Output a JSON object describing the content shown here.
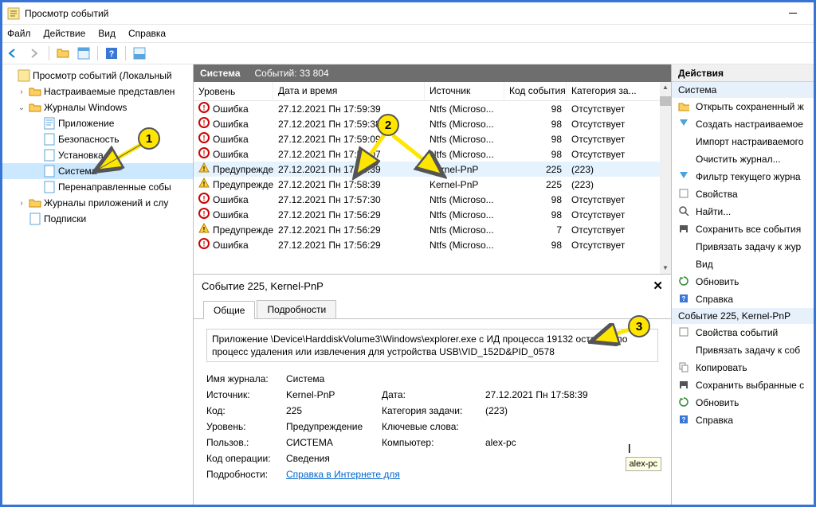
{
  "window": {
    "title": "Просмотр событий"
  },
  "menu": [
    "Файл",
    "Действие",
    "Вид",
    "Справка"
  ],
  "tree": {
    "root": "Просмотр событий (Локальный",
    "n1": "Настраиваемые представлен",
    "n2": "Журналы Windows",
    "n2a": "Приложение",
    "n2b": "Безопасность",
    "n2c": "Установка",
    "n2d": "Система",
    "n2e": "Перенаправленные собы",
    "n3": "Журналы приложений и слу",
    "n4": "Подписки"
  },
  "center_header": {
    "title": "Система",
    "count": "Событий: 33 804"
  },
  "cols": {
    "c0": "Уровень",
    "c1": "Дата и время",
    "c2": "Источник",
    "c3": "Код события",
    "c4": "Категория за..."
  },
  "events": [
    {
      "lvl": "Ошибка",
      "t": "err",
      "dt": "27.12.2021 Пн 17:59:39",
      "src": "Ntfs (Microso...",
      "code": "98",
      "cat": "Отсутствует"
    },
    {
      "lvl": "Ошибка",
      "t": "err",
      "dt": "27.12.2021 Пн 17:59:38",
      "src": "Ntfs (Microso...",
      "code": "98",
      "cat": "Отсутствует"
    },
    {
      "lvl": "Ошибка",
      "t": "err",
      "dt": "27.12.2021 Пн 17:59:09",
      "src": "Ntfs (Microso...",
      "code": "98",
      "cat": "Отсутствует"
    },
    {
      "lvl": "Ошибка",
      "t": "err",
      "dt": "27.12.2021 Пн 17:59:07",
      "src": "Ntfs (Microso...",
      "code": "98",
      "cat": "Отсутствует"
    },
    {
      "lvl": "Предупреждение",
      "t": "wrn",
      "dt": "27.12.2021 Пн 17:58:39",
      "src": "Kernel-PnP",
      "code": "225",
      "cat": "(223)",
      "sel": true
    },
    {
      "lvl": "Предупреждение",
      "t": "wrn",
      "dt": "27.12.2021 Пн 17:58:39",
      "src": "Kernel-PnP",
      "code": "225",
      "cat": "(223)"
    },
    {
      "lvl": "Ошибка",
      "t": "err",
      "dt": "27.12.2021 Пн 17:57:30",
      "src": "Ntfs (Microso...",
      "code": "98",
      "cat": "Отсутствует"
    },
    {
      "lvl": "Ошибка",
      "t": "err",
      "dt": "27.12.2021 Пн 17:56:29",
      "src": "Ntfs (Microso...",
      "code": "98",
      "cat": "Отсутствует"
    },
    {
      "lvl": "Предупреждение",
      "t": "wrn",
      "dt": "27.12.2021 Пн 17:56:29",
      "src": "Ntfs (Microso...",
      "code": "7",
      "cat": "Отсутствует"
    },
    {
      "lvl": "Ошибка",
      "t": "err",
      "dt": "27.12.2021 Пн 17:56:29",
      "src": "Ntfs (Microso...",
      "code": "98",
      "cat": "Отсутствует"
    }
  ],
  "detail": {
    "title": "Событие 225, Kernel-PnP",
    "tab_general": "Общие",
    "tab_details": "Подробности",
    "msg": "Приложение \\Device\\HarddiskVolume3\\Windows\\explorer.exe с ИД процесса 19132 остановило процесс удаления или извлечения для устройства USB\\VID_152D&PID_0578",
    "k_log": "Имя журнала:",
    "v_log": "Система",
    "k_src": "Источник:",
    "v_src": "Kernel-PnP",
    "k_date": "Дата:",
    "v_date": "27.12.2021 Пн 17:58:39",
    "k_code": "Код:",
    "v_code": "225",
    "k_cat": "Категория задачи:",
    "v_cat": "(223)",
    "k_lvl": "Уровень:",
    "v_lvl": "Предупреждение",
    "k_kw": "Ключевые слова:",
    "v_kw": "",
    "k_user": "Пользов.:",
    "v_user": "СИСТЕМА",
    "k_comp": "Компьютер:",
    "v_comp": "alex-pc",
    "k_op": "Код операции:",
    "v_op": "Сведения",
    "k_more": "Подробности:",
    "v_more": "Справка в Интернете для"
  },
  "actions": {
    "h": "Действия",
    "s1": "Система",
    "a": [
      "Открыть сохраненный ж",
      "Создать настраиваемое",
      "Импорт настраиваемого",
      "Очистить журнал...",
      "Фильтр текущего журна",
      "Свойства",
      "Найти...",
      "Сохранить все события",
      "Привязать задачу к жур",
      "Вид",
      "Обновить",
      "Справка"
    ],
    "s2": "Событие 225, Kernel-PnP",
    "b": [
      "Свойства событий",
      "Привязать задачу к соб",
      "Копировать",
      "Сохранить выбранные с",
      "Обновить",
      "Справка"
    ]
  },
  "tooltip": "alex-pc",
  "callouts": {
    "c1": "1",
    "c2": "2",
    "c3": "3"
  }
}
